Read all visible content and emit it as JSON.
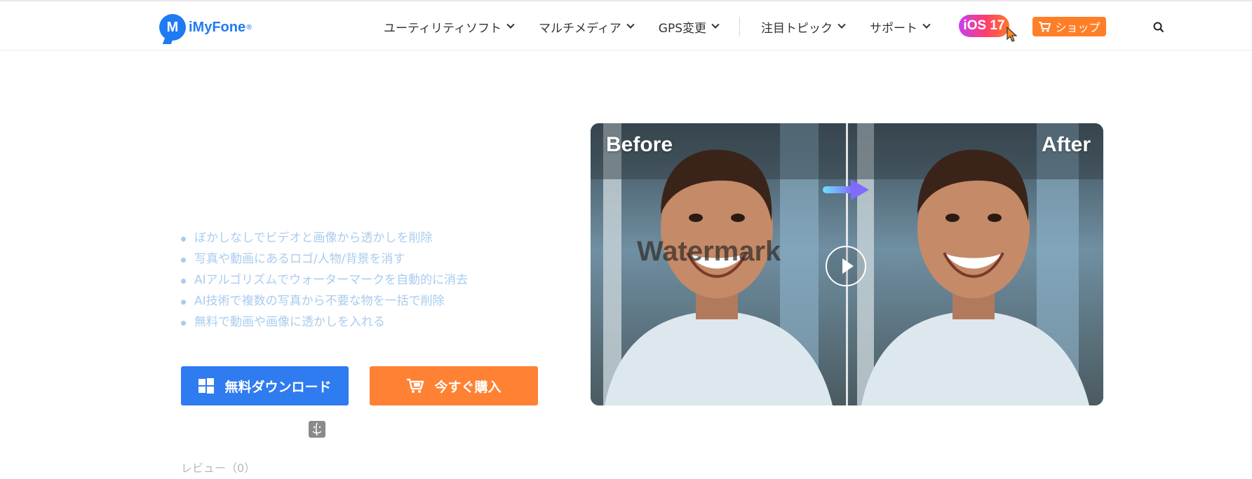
{
  "header": {
    "logo_text": "iMyFone",
    "logo_mark": "M",
    "logo_reg": "®",
    "nav": [
      {
        "label": "ユーティリティソフト"
      },
      {
        "label": "マルチメディア"
      },
      {
        "label": "GPS変更"
      },
      {
        "label": "注目トピック"
      },
      {
        "label": "サポート"
      }
    ],
    "ios_badge": "iOS 17",
    "shop_label": "ショップ",
    "icons": {
      "search": "search-icon",
      "cart": "cart-icon",
      "cursor": "cursor-icon"
    }
  },
  "main": {
    "features": [
      "ぼかしなしでビデオと画像から透かしを削除",
      "写真や動画にあるロゴ/人物/背景を消す",
      "AIアルゴリズムでウォーターマークを自動的に消去",
      "AI技術で複数の写真から不要な物を一括で削除",
      "無料で動画や画像に透かしを入れる"
    ],
    "download_label": "無料ダウンロード",
    "buy_label": "今すぐ購入",
    "review_text": "レビュー（0）"
  },
  "hero": {
    "before_label": "Before",
    "after_label": "After",
    "watermark_text": "Watermark"
  },
  "colors": {
    "brand_blue": "#1f7bf4",
    "download_blue": "#2f7bf0",
    "accent_orange": "#ff8133",
    "feature_text": "#a9ccef"
  }
}
